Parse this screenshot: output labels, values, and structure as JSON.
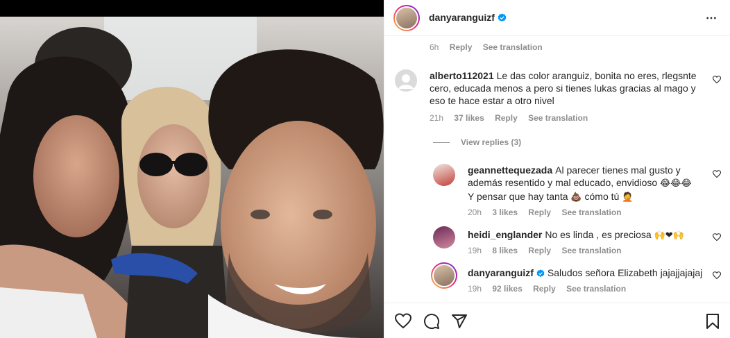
{
  "post": {
    "author": "danyaranguizf",
    "verified": true
  },
  "top_meta": {
    "time": "6h",
    "reply": "Reply",
    "see_translation": "See translation"
  },
  "comments": [
    {
      "username": "alberto112021",
      "text": "Le das color aranguiz, bonita no eres, rlegsnte cero, educada menos a pero si tienes lukas gracias al mago y eso te hace estar a otro nivel",
      "time": "21h",
      "likes": "37 likes",
      "reply": "Reply",
      "see_translation": "See translation",
      "view_replies": "View replies (3)"
    }
  ],
  "replies": [
    {
      "username": "geannettequezada",
      "text_line1": "Al parecer tienes mal gusto y",
      "text_line2": "además resentido y mal educado, envidioso",
      "text_line2_emoji": "😂😂😂",
      "text_line3": "Y pensar que hay tanta",
      "text_line3_emoji": "💩",
      "text_line3_end": "cómo tú",
      "text_line3_emoji2": "🤦",
      "time": "20h",
      "likes": "3 likes",
      "reply": "Reply",
      "see_translation": "See translation"
    },
    {
      "username": "heidi_englander",
      "text": "No es linda , es preciosa",
      "emoji": "🙌❤🙌",
      "time": "19h",
      "likes": "8 likes",
      "reply": "Reply",
      "see_translation": "See translation"
    },
    {
      "username": "danyaranguizf",
      "verified": true,
      "text": "Saludos señora Elizabeth jajajjajajaj",
      "time": "19h",
      "likes": "92 likes",
      "reply": "Reply",
      "see_translation": "See translation"
    }
  ],
  "icons": {
    "more": "more-horizontal-icon",
    "like": "heart-icon",
    "comment": "comment-icon",
    "share": "share-icon",
    "save": "bookmark-icon",
    "verified": "verified-badge-icon"
  },
  "colors": {
    "verified": "#0095f6",
    "muted": "#8e8e8e",
    "text": "#262626"
  }
}
